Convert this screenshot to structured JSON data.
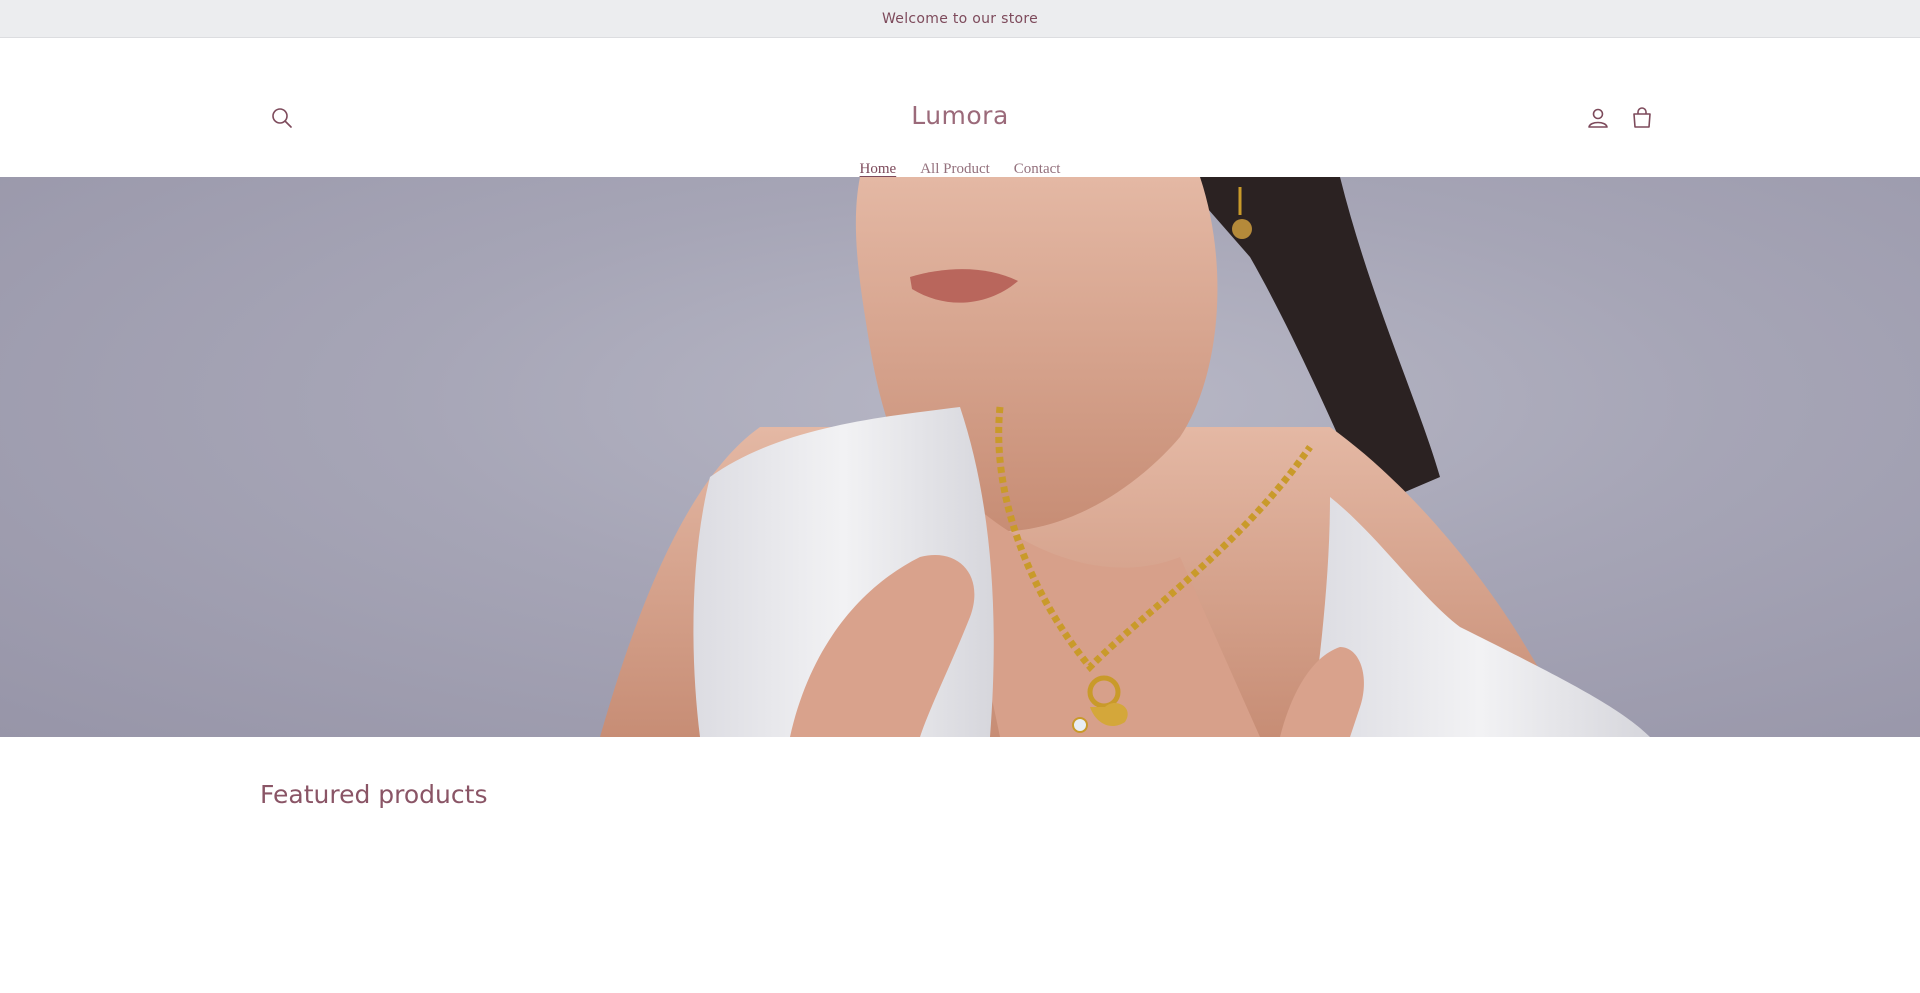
{
  "announcement": {
    "text": "Welcome to our store"
  },
  "header": {
    "logo": "Lumora",
    "icons": {
      "search": "search-icon",
      "account": "account-icon",
      "cart": "cart-icon"
    }
  },
  "nav": {
    "items": [
      {
        "label": "Home",
        "active": true
      },
      {
        "label": "All Product",
        "active": false
      },
      {
        "label": "Contact",
        "active": false
      }
    ]
  },
  "hero": {
    "image": "model-with-gold-necklace"
  },
  "featured": {
    "heading": "Featured products"
  },
  "colors": {
    "accent": "#7d4a5b",
    "announcement_bg": "#ecedef",
    "hero_bg": "#a6a5b6"
  }
}
